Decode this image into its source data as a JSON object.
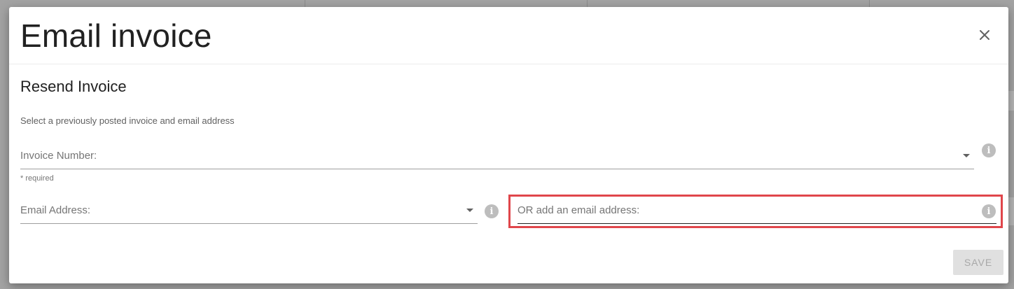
{
  "dialog": {
    "title": "Email invoice",
    "close_icon": "close-icon"
  },
  "section": {
    "title": "Resend Invoice",
    "helper_text": "Select a previously posted invoice and email address"
  },
  "invoice_field": {
    "label": "Invoice Number:",
    "required_note": "* required",
    "icon": "chevron-down-icon",
    "info_icon": "info-icon"
  },
  "email_select": {
    "label": "Email Address:",
    "icon": "chevron-down-icon",
    "info_icon": "info-icon"
  },
  "email_input": {
    "placeholder": "OR add an email address:",
    "info_icon": "info-icon",
    "highlight_color": "#e0464b"
  },
  "actions": {
    "save_label": "SAVE"
  }
}
